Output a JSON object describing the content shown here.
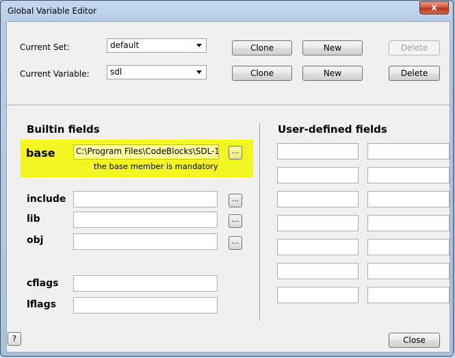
{
  "window": {
    "title": "Global Variable Editor",
    "close_glyph": "x"
  },
  "top": {
    "current_set_label": "Current Set:",
    "current_set_value": "default",
    "current_variable_label": "Current Variable:",
    "current_variable_value": "sdl",
    "set_clone": "Clone",
    "set_new": "New",
    "set_delete": "Delete",
    "var_clone": "Clone",
    "var_new": "New",
    "var_delete": "Delete"
  },
  "builtin": {
    "heading": "Builtin fields",
    "base_label": "base",
    "base_value": "C:\\Program Files\\CodeBlocks\\SDL-1",
    "base_hint": "the base member is mandatory",
    "include_label": "include",
    "include_value": "",
    "lib_label": "lib",
    "lib_value": "",
    "obj_label": "obj",
    "obj_value": "",
    "cflags_label": "cflags",
    "cflags_value": "",
    "lflags_label": "lflags",
    "lflags_value": "",
    "browse_label": "..."
  },
  "user_defined": {
    "heading": "User-defined fields",
    "rows": [
      {
        "name": "",
        "value": ""
      },
      {
        "name": "",
        "value": ""
      },
      {
        "name": "",
        "value": ""
      },
      {
        "name": "",
        "value": ""
      },
      {
        "name": "",
        "value": ""
      },
      {
        "name": "",
        "value": ""
      },
      {
        "name": "",
        "value": ""
      }
    ]
  },
  "footer": {
    "help_label": "?",
    "close_label": "Close"
  },
  "colors": {
    "highlight": "#f3f521",
    "title_gradient": "#b7cde6",
    "close_button": "#c8442a"
  },
  "icons": {
    "close": "close-icon",
    "help": "help-icon",
    "dropdown": "chevron-down-icon",
    "browse": "ellipsis-icon"
  }
}
